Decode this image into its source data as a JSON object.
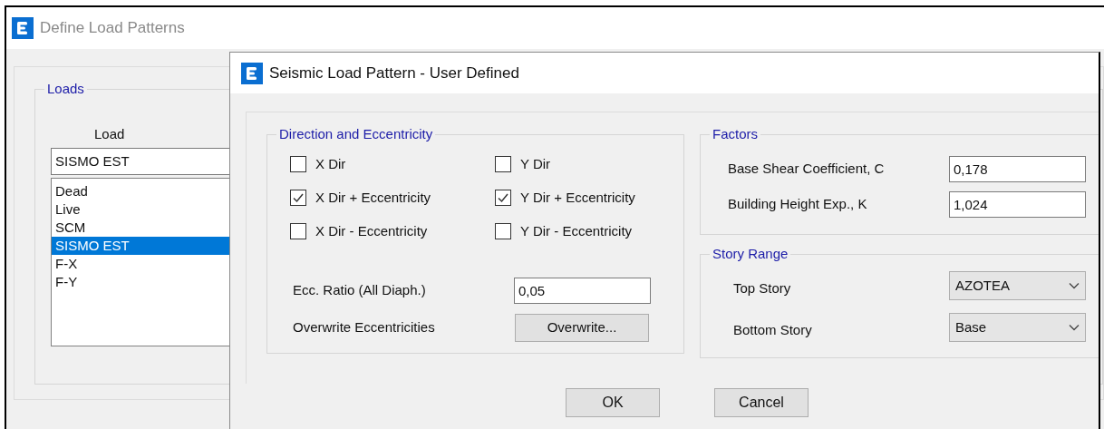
{
  "background_window": {
    "title": "Define Load Patterns",
    "loads_group": {
      "title": "Loads",
      "column_header": "Load",
      "load_name": "SISMO EST",
      "items": [
        {
          "label": "Dead",
          "selected": false
        },
        {
          "label": "Live",
          "selected": false
        },
        {
          "label": "SCM",
          "selected": false
        },
        {
          "label": "SISMO EST",
          "selected": true
        },
        {
          "label": "F-X",
          "selected": false
        },
        {
          "label": "F-Y",
          "selected": false
        }
      ]
    }
  },
  "dialog": {
    "title": "Seismic Load Pattern - User Defined",
    "direction_group": {
      "title": "Direction and Eccentricity",
      "options": [
        {
          "label": "X Dir",
          "checked": false
        },
        {
          "label": "Y Dir",
          "checked": false
        },
        {
          "label": "X Dir + Eccentricity",
          "checked": true
        },
        {
          "label": "Y Dir + Eccentricity",
          "checked": true
        },
        {
          "label": "X Dir - Eccentricity",
          "checked": false
        },
        {
          "label": "Y Dir - Eccentricity",
          "checked": false
        }
      ],
      "ecc_ratio": {
        "label": "Ecc. Ratio (All Diaph.)",
        "value": "0,05"
      },
      "overwrite": {
        "label": "Overwrite Eccentricities",
        "button": "Overwrite..."
      }
    },
    "factors": {
      "title": "Factors",
      "fields": [
        {
          "label": "Base Shear Coefficient, C",
          "value": "0,178"
        },
        {
          "label": "Building Height Exp., K",
          "value": "1,024"
        }
      ]
    },
    "story_range": {
      "title": "Story Range",
      "fields": [
        {
          "label": "Top Story",
          "value": "AZOTEA"
        },
        {
          "label": "Bottom Story",
          "value": "Base"
        }
      ]
    },
    "buttons": [
      "OK",
      "Cancel"
    ]
  }
}
